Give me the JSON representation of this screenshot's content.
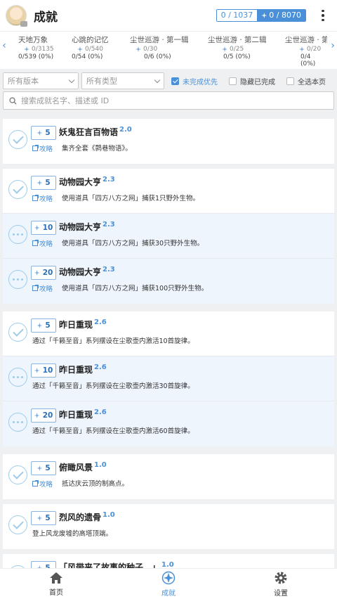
{
  "header": {
    "title": "成就",
    "count_label": "0 / 1037",
    "primo_label": "0 / 8070"
  },
  "categories": [
    {
      "name": "天地万象",
      "progress": "0/3135",
      "percent": "0/539 (0%)"
    },
    {
      "name": "心跳的记忆",
      "progress": "0/540",
      "percent": "0/54 (0%)"
    },
    {
      "name": "尘世巡游 · 第一辑",
      "progress": "0/30",
      "percent": "0/6 (0%)"
    },
    {
      "name": "尘世巡游 · 第二辑",
      "progress": "0/25",
      "percent": "0/5 (0%)"
    },
    {
      "name": "尘世巡游 · 第三",
      "progress": "0/20",
      "percent": "0/4 (0%)"
    }
  ],
  "filters": {
    "version_placeholder": "所有版本",
    "type_placeholder": "所有类型",
    "unfinished_first": "未完成优先",
    "hide_done": "隐藏已完成",
    "select_all": "全选本页",
    "search_placeholder": "搜索成就名字、描述或 ID"
  },
  "guide_label": "攻略",
  "groups": [
    {
      "items": [
        {
          "reward": "5",
          "name": "妖鬼狂言百物语",
          "ver": "2.0",
          "desc": "集齐全套《鹮巷物语》。",
          "guide": true,
          "status": "done"
        }
      ]
    },
    {
      "items": [
        {
          "reward": "5",
          "name": "动物园大亨",
          "ver": "2.3",
          "desc": "使用道具「四方八方之网」捕获1只野外生物。",
          "guide": true,
          "status": "done"
        },
        {
          "reward": "10",
          "name": "动物园大亨",
          "ver": "2.3",
          "desc": "使用道具「四方八方之网」捕获30只野外生物。",
          "guide": true,
          "status": "pending"
        },
        {
          "reward": "20",
          "name": "动物园大亨",
          "ver": "2.3",
          "desc": "使用道具「四方八方之网」捕获100只野外生物。",
          "guide": true,
          "status": "pending"
        }
      ]
    },
    {
      "items": [
        {
          "reward": "5",
          "name": "昨日重现",
          "ver": "2.6",
          "desc": "通过「千籁至音」系列摆设在尘歌壶内激活10首旋律。",
          "guide": false,
          "status": "done"
        },
        {
          "reward": "10",
          "name": "昨日重现",
          "ver": "2.6",
          "desc": "通过「千籁至音」系列摆设在尘歌壶内激活30首旋律。",
          "guide": false,
          "status": "pending"
        },
        {
          "reward": "20",
          "name": "昨日重现",
          "ver": "2.6",
          "desc": "通过「千籁至音」系列摆设在尘歌壶内激活60首旋律。",
          "guide": false,
          "status": "pending"
        }
      ]
    },
    {
      "items": [
        {
          "reward": "5",
          "name": "俯瞰风景",
          "ver": "1.0",
          "desc": "抵达庆云顶的制高点。",
          "guide": true,
          "status": "done"
        }
      ]
    },
    {
      "items": [
        {
          "reward": "5",
          "name": "烈风的遗骨",
          "ver": "1.0",
          "desc": "登上风龙废墟的高塔顶端。",
          "guide": false,
          "status": "done"
        }
      ]
    },
    {
      "items": [
        {
          "reward": "5",
          "name": "「风带来了故事的种子…」",
          "ver": "1.0",
          "desc": "",
          "guide": false,
          "status": "done"
        }
      ]
    }
  ],
  "nav": [
    {
      "label": "首页",
      "icon": "home-icon"
    },
    {
      "label": "成就",
      "icon": "achievement-icon",
      "active": true
    },
    {
      "label": "设置",
      "icon": "gear-icon"
    }
  ],
  "colors": {
    "accent": "#4a90d9",
    "pending_bg": "#eef5fd"
  }
}
